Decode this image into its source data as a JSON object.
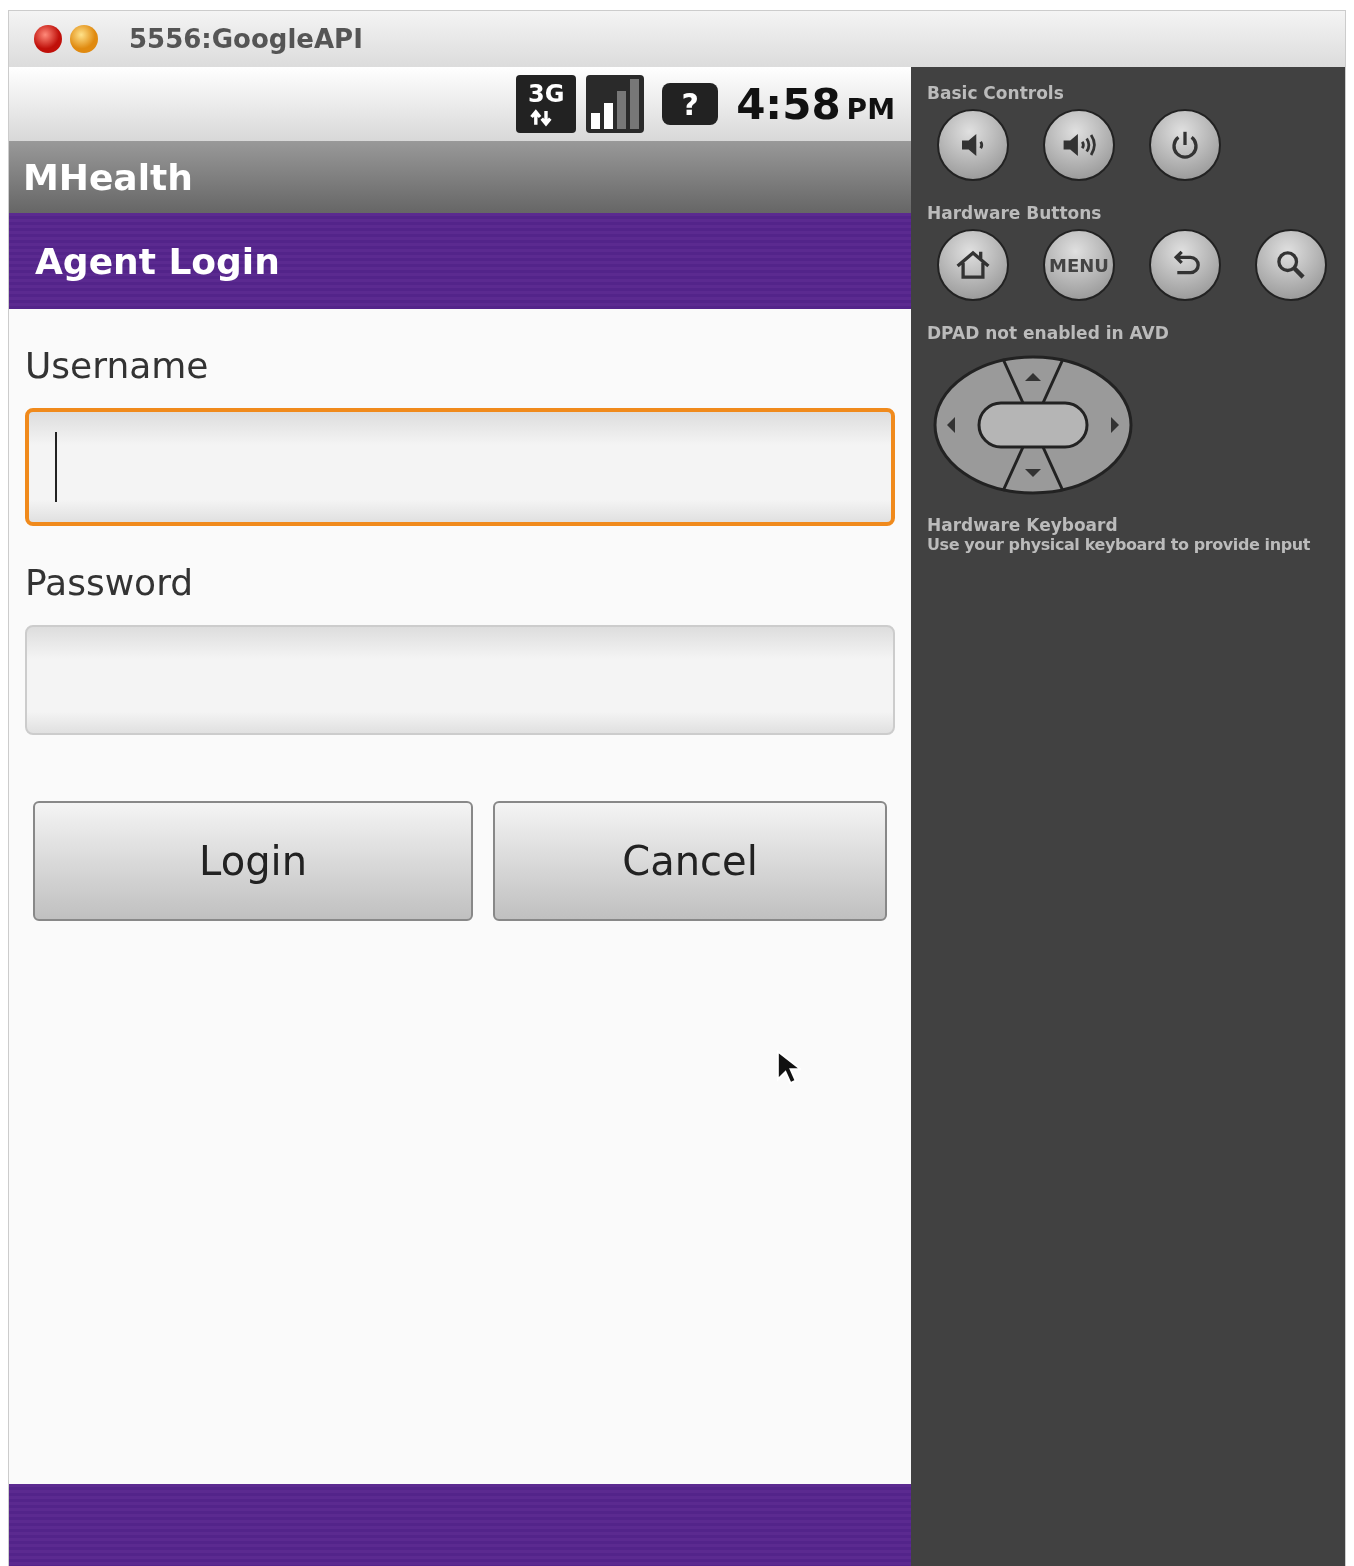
{
  "window": {
    "title": "5556:GoogleAPI"
  },
  "status_bar": {
    "network_type": "3G",
    "battery_glyph": "?",
    "time": "4:58",
    "time_suffix": "PM"
  },
  "app_bar": {
    "title": "MHealth"
  },
  "header": {
    "title": "Agent Login"
  },
  "form": {
    "fields": [
      {
        "label": "Username",
        "focused": true
      },
      {
        "label": "Password",
        "focused": false
      }
    ],
    "buttons": [
      "Login",
      "Cancel"
    ]
  },
  "controls": [
    {
      "kind": "buttons",
      "title": "Basic Controls",
      "buttons": [
        {
          "kind": "volume-down"
        },
        {
          "kind": "volume-up"
        },
        {
          "kind": "power"
        }
      ]
    },
    {
      "kind": "buttons",
      "title": "Hardware Buttons",
      "buttons": [
        {
          "kind": "home"
        },
        {
          "kind": "menu",
          "label": "MENU"
        },
        {
          "kind": "back"
        },
        {
          "kind": "search"
        }
      ]
    },
    {
      "kind": "dpad",
      "title": "DPAD not enabled in AVD"
    },
    {
      "kind": "note",
      "title": "Hardware Keyboard",
      "text": "Use your physical keyboard to provide input"
    }
  ]
}
